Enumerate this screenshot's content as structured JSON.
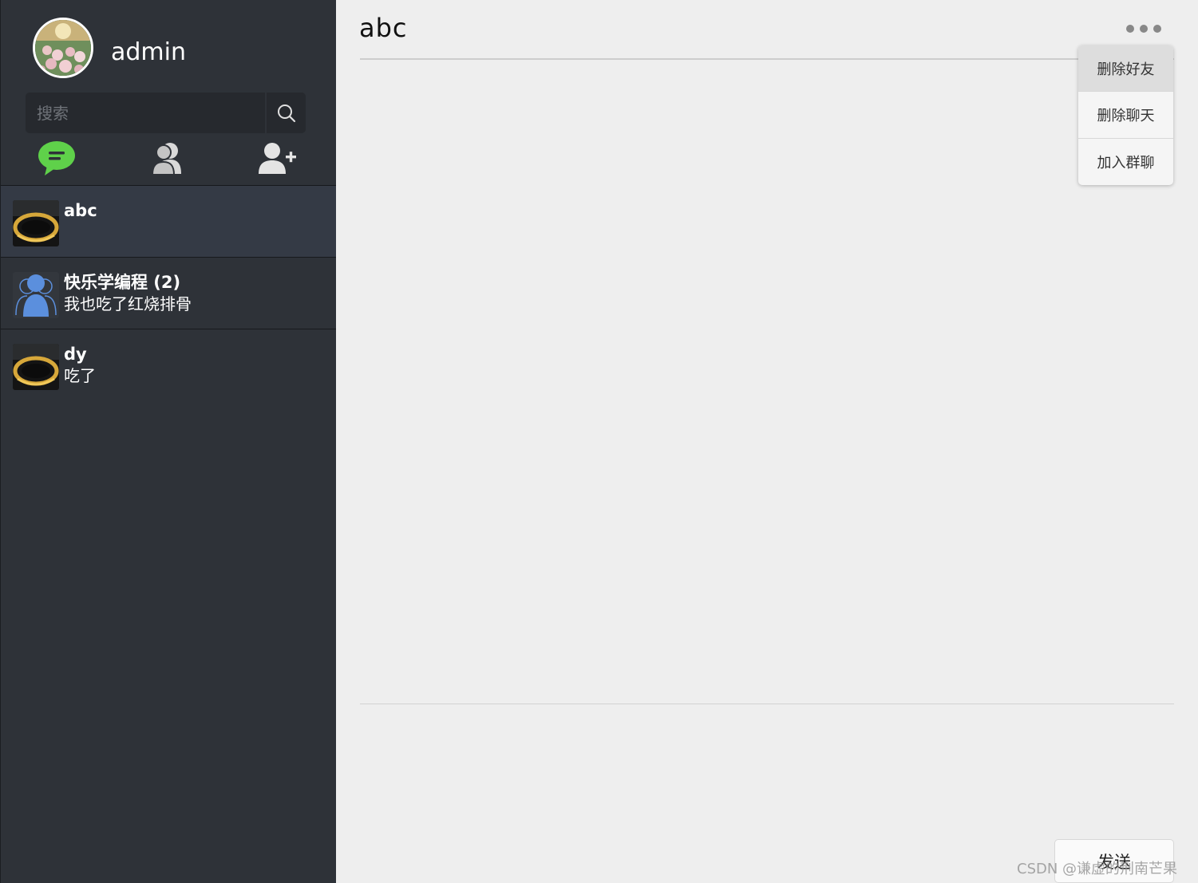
{
  "sidebar": {
    "profile": {
      "username": "admin"
    },
    "search": {
      "placeholder": "搜索"
    },
    "nav": {
      "chat_icon": "chat-bubble-icon",
      "contacts_icon": "contacts-icon",
      "add_friend_icon": "add-user-icon"
    },
    "conversations": [
      {
        "name": "abc",
        "last_message": "",
        "active": true
      },
      {
        "name": "快乐学编程 (2)",
        "last_message": "我也吃了红烧排骨",
        "active": false
      },
      {
        "name": "dy",
        "last_message": "吃了",
        "active": false
      }
    ]
  },
  "chat": {
    "title": "abc",
    "menu": {
      "items": [
        "删除好友",
        "删除聊天",
        "加入群聊"
      ]
    },
    "send_label": "发送"
  },
  "watermark": "CSDN @谦虚的荆南芒果",
  "colors": {
    "sidebar_bg": "#2e3238",
    "active_item_bg": "#343a45",
    "chat_icon_green": "#5fd14a",
    "main_bg": "#eeeeee",
    "group_avatar_blue": "#5b8fdd"
  }
}
